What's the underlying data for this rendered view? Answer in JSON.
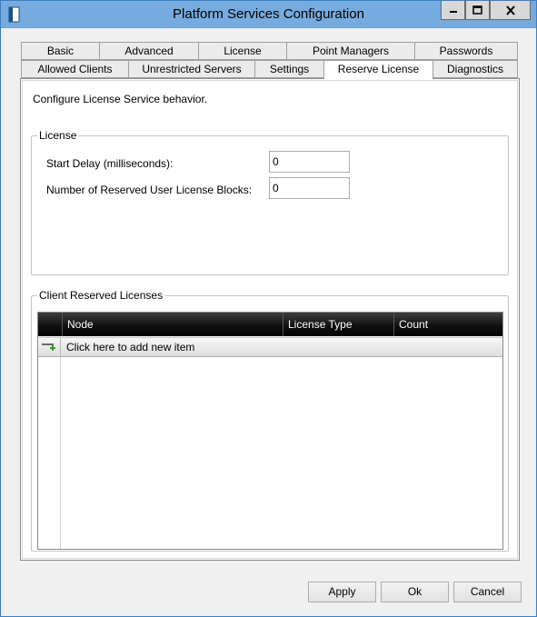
{
  "window": {
    "title": "Platform Services Configuration",
    "icon": "book-icon"
  },
  "tabs_row1": [
    {
      "label": "Basic"
    },
    {
      "label": "Advanced"
    },
    {
      "label": "License"
    },
    {
      "label": "Point Managers"
    },
    {
      "label": "Passwords"
    }
  ],
  "tabs_row2": [
    {
      "label": "Allowed Clients"
    },
    {
      "label": "Unrestricted Servers"
    },
    {
      "label": "Settings"
    },
    {
      "label": "Reserve License",
      "active": true
    },
    {
      "label": "Diagnostics"
    }
  ],
  "panel": {
    "description": "Configure License Service behavior.",
    "license_group": {
      "label": "License",
      "start_delay_label": "Start Delay (milliseconds):",
      "start_delay_value": "0",
      "reserved_blocks_label": "Number of Reserved User License Blocks:",
      "reserved_blocks_value": "0"
    },
    "client_group": {
      "label": "Client Reserved Licenses",
      "columns": [
        "Node",
        "License Type",
        "Count"
      ],
      "add_row_text": "Click here to add new item"
    }
  },
  "buttons": {
    "apply": "Apply",
    "ok": "Ok",
    "cancel": "Cancel"
  },
  "colors": {
    "titlebar": "#76abe0",
    "grid_header": "#000000",
    "panel_bg": "#ffffff"
  }
}
